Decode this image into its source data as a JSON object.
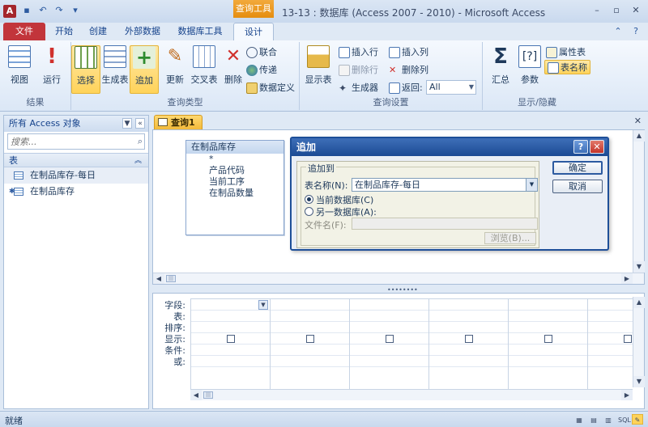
{
  "window": {
    "title": "13-13 : 数据库 (Access 2007 - 2010)  -  Microsoft Access",
    "context_tab": "查询工具",
    "app_icon": "A"
  },
  "tabs": [
    "文件",
    "开始",
    "创建",
    "外部数据",
    "数据库工具",
    "设计"
  ],
  "ribbon": {
    "results": {
      "label": "结果",
      "view": "视图",
      "run": "运行"
    },
    "query_type": {
      "label": "查询类型",
      "select": "选择",
      "make_table": "生成表",
      "append": "追加",
      "update": "更新",
      "crosstab": "交叉表",
      "delete": "删除",
      "union": "联合",
      "passthrough": "传递",
      "data_definition": "数据定义"
    },
    "query_setup": {
      "label": "查询设置",
      "show_table": "显示表",
      "insert_rows": "插入行",
      "delete_rows": "删除行",
      "builder": "生成器",
      "insert_cols": "插入列",
      "delete_cols": "删除列",
      "return_label": "返回:",
      "return_value": "All"
    },
    "show_hide": {
      "label": "显示/隐藏",
      "totals": "汇总",
      "parameters": "参数",
      "property_sheet": "属性表",
      "table_names": "表名称"
    }
  },
  "nav": {
    "header": "所有 Access 对象",
    "search_placeholder": "搜索...",
    "group": "表",
    "items": [
      "在制品库存-每日",
      "在制品库存"
    ]
  },
  "document": {
    "tab": "查询1",
    "table_box": {
      "title": "在制品库存",
      "fields": [
        "*",
        "产品代码",
        "当前工序",
        "在制品数量"
      ]
    },
    "grid_rows": [
      "字段:",
      "表:",
      "排序:",
      "显示:",
      "条件:",
      "或:"
    ]
  },
  "dialog": {
    "title": "追加",
    "group_label": "追加到",
    "table_name_label": "表名称(N):",
    "table_name_value": "在制品库存-每日",
    "current_db": "当前数据库(C)",
    "other_db": "另一数据库(A):",
    "file_name_label": "文件名(F):",
    "browse": "浏览(B)...",
    "ok": "确定",
    "cancel": "取消"
  },
  "status": {
    "text": "就绪",
    "sql_label": "SQL"
  }
}
